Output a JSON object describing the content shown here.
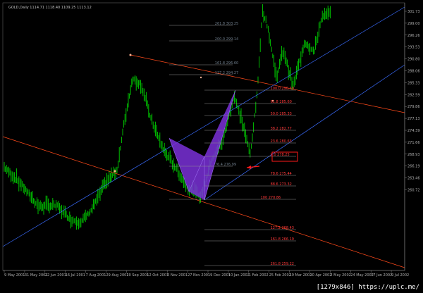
{
  "header": {
    "symbol_info": "GOLD,Daily  1114.71  1118.40  1109.25  1113.12"
  },
  "colors": {
    "background": "#000000",
    "candle": "#00d000",
    "trend_lines": "#ff4a1a",
    "diag_lines": "#3a6cff",
    "pattern": "#7a30d8",
    "fib_lines": "#9a9a9a",
    "fib_labels_red": "#ff3a3a",
    "fib_labels_dim": "#6e7c8a",
    "axis": "#b0b0b0",
    "highlight_box": "#ff1a1a"
  },
  "price_axis": [
    "301.73",
    "299.00",
    "296.26",
    "293.53",
    "290.80",
    "288.06",
    "285.33",
    "282.59",
    "279.86",
    "277.13",
    "274.39",
    "271.66",
    "268.93",
    "266.19",
    "263.46",
    "260.72"
  ],
  "time_axis": [
    "9 May 2001",
    "31 May 2001",
    "22 Jun 2001",
    "16 Jul 2001",
    "7 Aug 2001",
    "29 Aug 2001",
    "20 Sep 2001",
    "12 Oct 2001",
    "5 Nov 2001",
    "27 Nov 2001",
    "19 Dec 2001",
    "10 Jan 2002",
    "1 Feb 2002",
    "25 Feb 2002",
    "19 Mar 2002",
    "10 Apr 2002",
    "2 May 2002",
    "24 May 2002",
    "17 Jun 2002",
    "9 Jul 2002"
  ],
  "fib_levels": [
    "261.8 303.25",
    "200.0 299.14",
    "161.8 296.60",
    "127.2 294.27",
    "100.0 290.49",
    "61.8 285.60",
    "50.0 285.33",
    "38.2 282.77",
    "23.6 280.63",
    "0.0 278.25",
    "76.4 276.99",
    "78.6 275.44",
    "88.6 273.32",
    "100 270.86",
    "127.2 268.43",
    "161.8 266.19",
    "261.8 259.22"
  ],
  "watermark": "[1279x846] https://uplc.me/"
}
